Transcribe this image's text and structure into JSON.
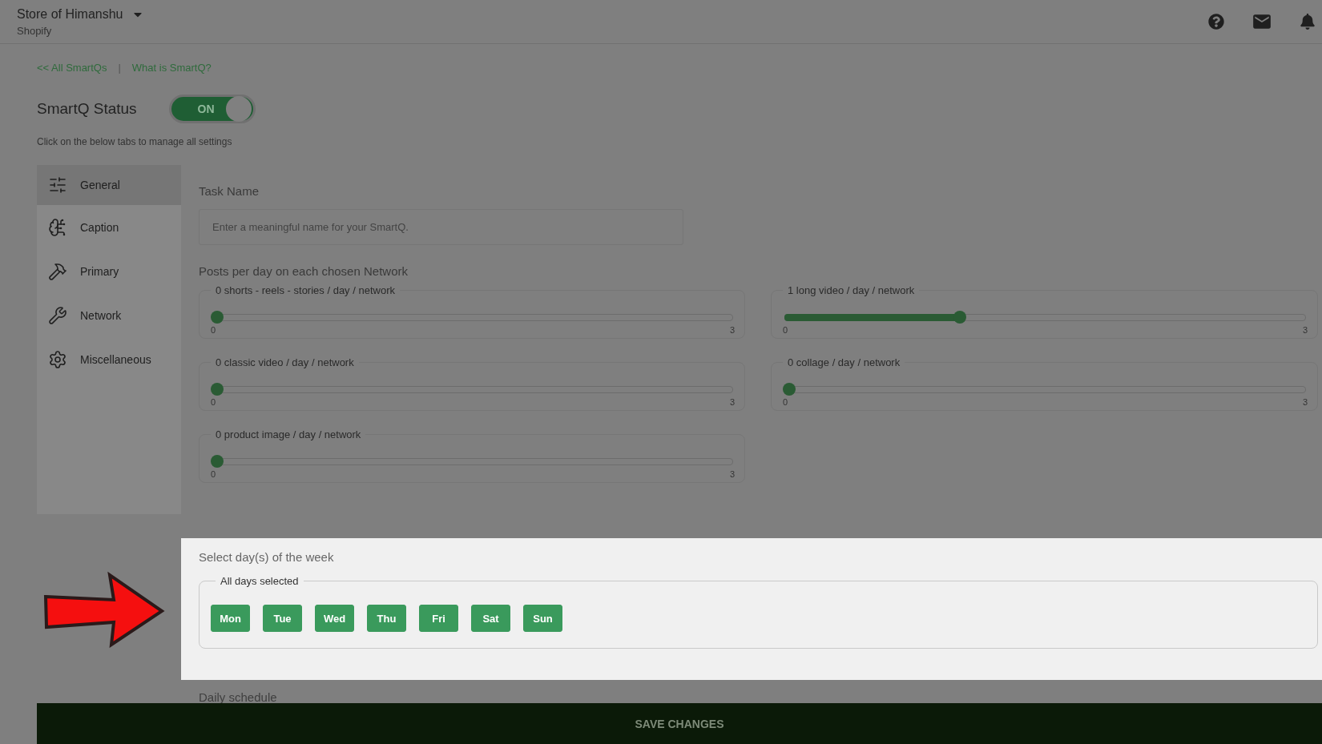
{
  "header": {
    "store": "Store of Himanshu",
    "platform": "Shopify"
  },
  "links": {
    "back": "<< All SmartQs",
    "separator": "|",
    "help": "What is SmartQ?"
  },
  "status": {
    "title": "SmartQ Status",
    "toggle": {
      "label": "ON",
      "on": true
    },
    "hint": "Click on the below tabs to manage all settings"
  },
  "tabs": [
    {
      "label": "General",
      "selected": true
    },
    {
      "label": "Caption",
      "selected": false
    },
    {
      "label": "Primary",
      "selected": false
    },
    {
      "label": "Network",
      "selected": false
    },
    {
      "label": "Miscellaneous",
      "selected": false
    }
  ],
  "task_name": {
    "label": "Task Name",
    "placeholder": "Enter a meaningful name for your SmartQ."
  },
  "posts": {
    "label": "Posts per day on each chosen Network",
    "sliders": [
      {
        "label": "0 shorts - reels - stories / day / network",
        "level": 0,
        "min": "0",
        "max": "3"
      },
      {
        "label": "1 long video / day / network",
        "level": 0.333,
        "min": "0",
        "max": "3"
      },
      {
        "label": "0 classic video / day / network",
        "level": 0,
        "min": "0",
        "max": "3"
      },
      {
        "label": "0 collage / day / network",
        "level": 0,
        "min": "0",
        "max": "3"
      },
      {
        "label": "0 product image / day / network",
        "level": 0,
        "min": "0",
        "max": "3"
      }
    ]
  },
  "days": {
    "label": "Select day(s) of the week",
    "legend": "All days selected",
    "items": [
      {
        "label": "Mon",
        "selected": true
      },
      {
        "label": "Tue",
        "selected": true
      },
      {
        "label": "Wed",
        "selected": true
      },
      {
        "label": "Thu",
        "selected": true
      },
      {
        "label": "Fri",
        "selected": true
      },
      {
        "label": "Sat",
        "selected": true
      },
      {
        "label": "Sun",
        "selected": true
      }
    ]
  },
  "daily_schedule": "Daily schedule",
  "save": "SAVE CHANGES"
}
